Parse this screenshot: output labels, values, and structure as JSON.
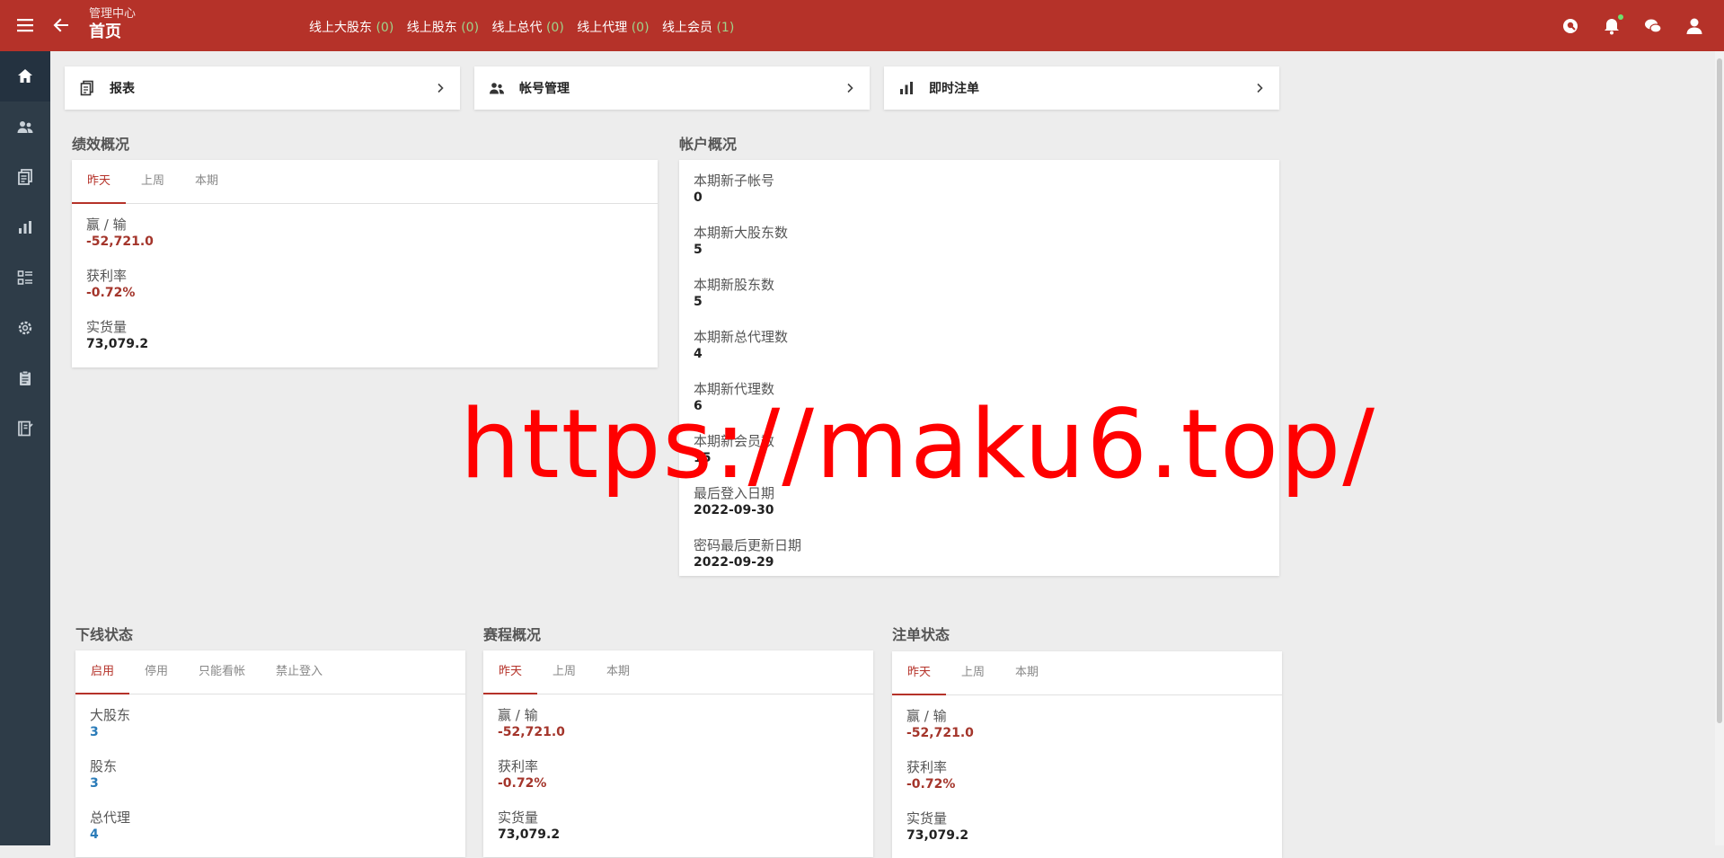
{
  "header": {
    "subtitle": "管理中心",
    "title": "首页",
    "online": [
      {
        "label": "线上大股东",
        "count": "(0)"
      },
      {
        "label": "线上股东",
        "count": "(0)"
      },
      {
        "label": "线上总代",
        "count": "(0)"
      },
      {
        "label": "线上代理",
        "count": "(0)"
      },
      {
        "label": "线上会员",
        "count": "(1)"
      }
    ]
  },
  "shortcuts": [
    {
      "label": "报表"
    },
    {
      "label": "帐号管理"
    },
    {
      "label": "即时注单"
    }
  ],
  "performance": {
    "title": "绩效概况",
    "tabs": [
      "昨天",
      "上周",
      "本期"
    ],
    "items": [
      {
        "k": "赢 / 输",
        "v": "-52,721.0"
      },
      {
        "k": "获利率",
        "v": "-0.72%"
      },
      {
        "k": "实货量",
        "v": "73,079.2"
      }
    ]
  },
  "account": {
    "title": "帐户概况",
    "items": [
      {
        "k": "本期新子帐号",
        "v": "0"
      },
      {
        "k": "本期新大股东数",
        "v": "5"
      },
      {
        "k": "本期新股东数",
        "v": "5"
      },
      {
        "k": "本期新总代理数",
        "v": "4"
      },
      {
        "k": "本期新代理数",
        "v": "6"
      },
      {
        "k": "本期新会员数",
        "v": "15"
      },
      {
        "k": "最后登入日期",
        "v": "2022-09-30"
      },
      {
        "k": "密码最后更新日期",
        "v": "2022-09-29"
      }
    ]
  },
  "downline": {
    "title": "下线状态",
    "tabs": [
      "启用",
      "停用",
      "只能看帐",
      "禁止登入"
    ],
    "items": [
      {
        "k": "大股东",
        "v": "3"
      },
      {
        "k": "股东",
        "v": "3"
      },
      {
        "k": "总代理",
        "v": "4"
      }
    ]
  },
  "events": {
    "title": "赛程概况",
    "tabs": [
      "昨天",
      "上周",
      "本期"
    ],
    "items": [
      {
        "k": "赢 / 输",
        "v": "-52,721.0"
      },
      {
        "k": "获利率",
        "v": "-0.72%"
      },
      {
        "k": "实货量",
        "v": "73,079.2"
      }
    ]
  },
  "bets": {
    "title": "注单状态",
    "tabs": [
      "昨天",
      "上周",
      "本期"
    ],
    "items": [
      {
        "k": "赢 / 输",
        "v": "-52,721.0"
      },
      {
        "k": "获利率",
        "v": "-0.72%"
      },
      {
        "k": "实货量",
        "v": "73,079.2"
      }
    ]
  },
  "watermark": "https://maku6.top/",
  "colors": {
    "brand": "#b53229",
    "sidebar": "#2e3c48",
    "negative": "#a4352b",
    "count": "#2a7bb8"
  }
}
